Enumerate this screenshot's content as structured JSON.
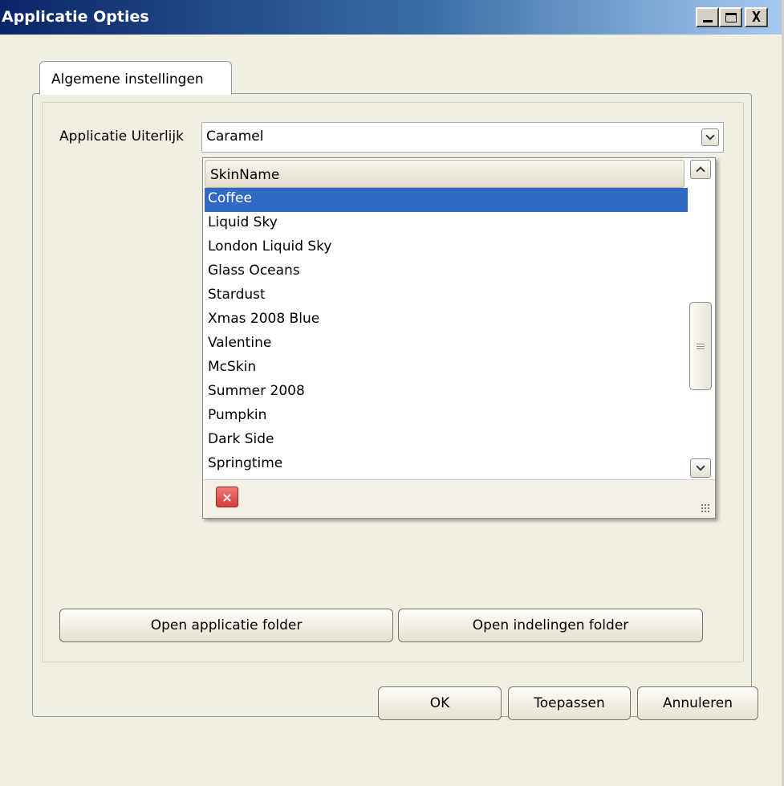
{
  "window": {
    "title": "Applicatie Opties",
    "minimize_glyph": "_",
    "close_glyph": "X"
  },
  "tabs": [
    {
      "label": "Algemene instellingen",
      "selected": true
    }
  ],
  "appearance": {
    "label": "Applicatie Uiterlijk",
    "selected_value": "Caramel"
  },
  "dropdown": {
    "column_header": "SkinName",
    "items": [
      {
        "label": "Coffee",
        "selected": true
      },
      {
        "label": "Liquid Sky",
        "selected": false
      },
      {
        "label": "London Liquid Sky",
        "selected": false
      },
      {
        "label": "Glass Oceans",
        "selected": false
      },
      {
        "label": "Stardust",
        "selected": false
      },
      {
        "label": "Xmas 2008 Blue",
        "selected": false
      },
      {
        "label": "Valentine",
        "selected": false
      },
      {
        "label": "McSkin",
        "selected": false
      },
      {
        "label": "Summer 2008",
        "selected": false
      },
      {
        "label": "Pumpkin",
        "selected": false
      },
      {
        "label": "Dark Side",
        "selected": false
      },
      {
        "label": "Springtime",
        "selected": false
      }
    ],
    "clear_glyph": "×",
    "scroll_position": 0.45
  },
  "buttons": {
    "open_app_folder": "Open applicatie folder",
    "open_layouts_folder": "Open indelingen folder",
    "ok": "OK",
    "apply": "Toepassen",
    "cancel": "Annuleren"
  },
  "colors": {
    "titlebar_start": "#0a246a",
    "titlebar_end": "#a6caf0",
    "selection": "#316ac5",
    "background": "#f1efe2"
  }
}
